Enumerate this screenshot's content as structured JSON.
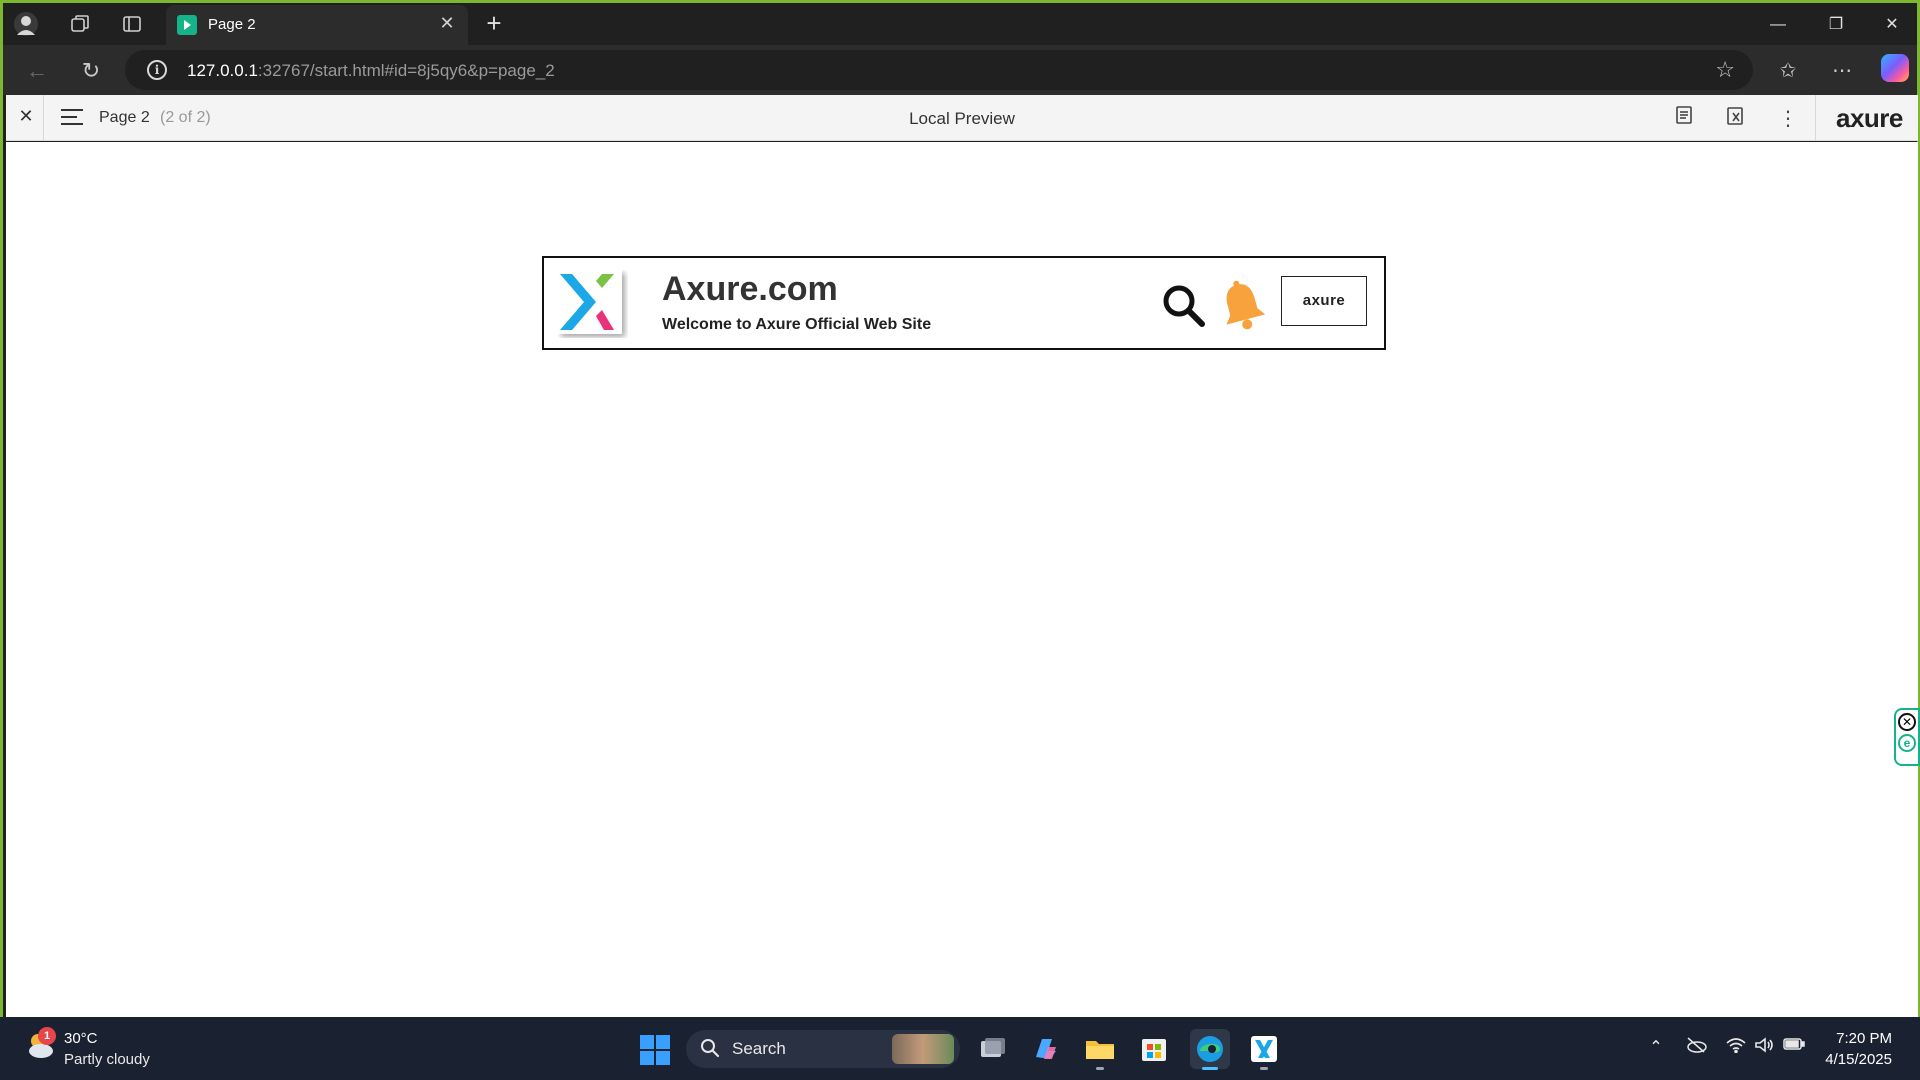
{
  "browser": {
    "tab_title": "Page 2",
    "url_host": "127.0.0.1",
    "url_path": ":32767/start.html#id=8j5qy6&p=page_2"
  },
  "axure_toolbar": {
    "page_name": "Page 2",
    "page_count": "(2 of 2)",
    "center_title": "Local Preview",
    "logo": "axure"
  },
  "widget": {
    "title": "Axure.com",
    "subtitle": "Welcome to Axure Official Web Site",
    "button_label": "axure"
  },
  "taskbar": {
    "weather_badge": "1",
    "weather_temp": "30°C",
    "weather_desc": "Partly cloudy",
    "search_label": "Search",
    "time": "7:20 PM",
    "date": "4/15/2025"
  },
  "colors": {
    "window_border": "#7cb82f",
    "accent_teal": "#16b38a",
    "bell": "#f7a23c",
    "logo_blue": "#1aa7e6",
    "logo_green": "#7cc242",
    "logo_pink": "#e8307a"
  }
}
